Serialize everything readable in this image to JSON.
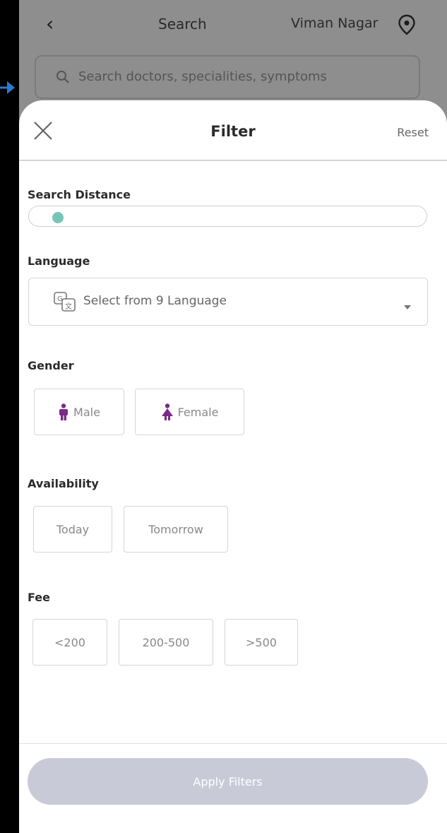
{
  "background": {
    "title": "Search",
    "location": "Viman Nagar",
    "search_placeholder": "Search doctors, specialities, symptoms"
  },
  "filter": {
    "title": "Filter",
    "reset_label": "Reset",
    "search_distance": {
      "label": "Search Distance",
      "value_fraction": 0.07
    },
    "language": {
      "label": "Language",
      "placeholder": "Select from 9 Language"
    },
    "gender": {
      "label": "Gender",
      "options": [
        "Male",
        "Female"
      ]
    },
    "availability": {
      "label": "Availability",
      "options": [
        "Today",
        "Tomorrow"
      ]
    },
    "fee": {
      "label": "Fee",
      "options": [
        "<200",
        "200-500",
        ">500"
      ]
    },
    "apply_label": "Apply Filters"
  },
  "colors": {
    "accent_slider": "#76c5b8",
    "gender_icon": "#7b2a86",
    "apply_button_disabled": "#c9cad8"
  }
}
